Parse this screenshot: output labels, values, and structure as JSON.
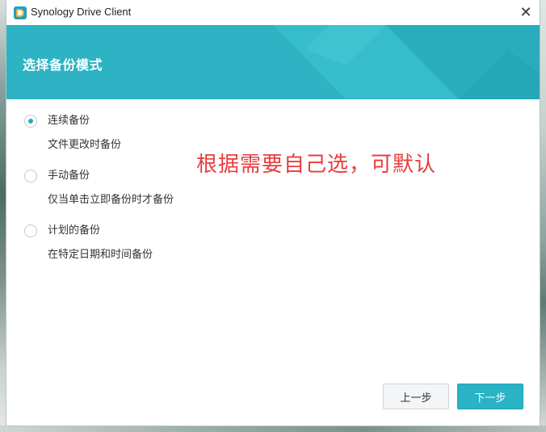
{
  "window": {
    "title": "Synology Drive Client",
    "close_glyph": "✕"
  },
  "header": {
    "title": "选择备份模式",
    "color": "#2db3c3"
  },
  "options": [
    {
      "label": "连续备份",
      "description": "文件更改时备份",
      "selected": true
    },
    {
      "label": "手动备份",
      "description": "仅当单击立即备份时才备份",
      "selected": false
    },
    {
      "label": "计划的备份",
      "description": "在特定日期和时间备份",
      "selected": false
    }
  ],
  "annotation": {
    "text": "根据需要自己选，可默认",
    "color": "#e83c3c"
  },
  "buttons": {
    "prev_label": "上一步",
    "next_label": "下一步"
  },
  "icons": {
    "app": "synology-drive-icon",
    "close": "close-icon"
  }
}
